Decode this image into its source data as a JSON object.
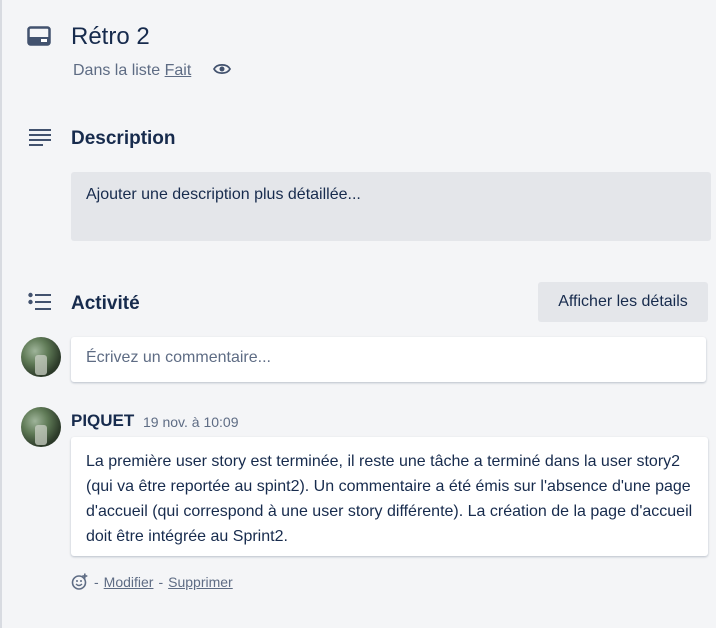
{
  "card": {
    "title": "Rétro 2",
    "in_list_prefix": "Dans la liste",
    "list_name": "Fait"
  },
  "description": {
    "heading": "Description",
    "placeholder": "Ajouter une description plus détaillée..."
  },
  "activity": {
    "heading": "Activité",
    "details_button": "Afficher les détails",
    "comment_placeholder": "Écrivez un commentaire..."
  },
  "comment": {
    "author": "PIQUET",
    "timestamp": "19 nov. à 10:09",
    "text": "La première user story est terminée, il reste une tâche a terminé dans la user story2 (qui va être reportée au spint2). Un commentaire a été émis sur l'absence d'une page d'accueil (qui correspond à une user story différente). La création de la page d'accueil doit être intégrée au Sprint2.",
    "separator": "-",
    "edit_label": "Modifier",
    "delete_label": "Supprimer"
  },
  "icons": {
    "card": "card-icon",
    "watch": "eye-icon",
    "description": "description-lines-icon",
    "activity": "activity-list-icon",
    "reaction": "add-reaction-icon"
  }
}
